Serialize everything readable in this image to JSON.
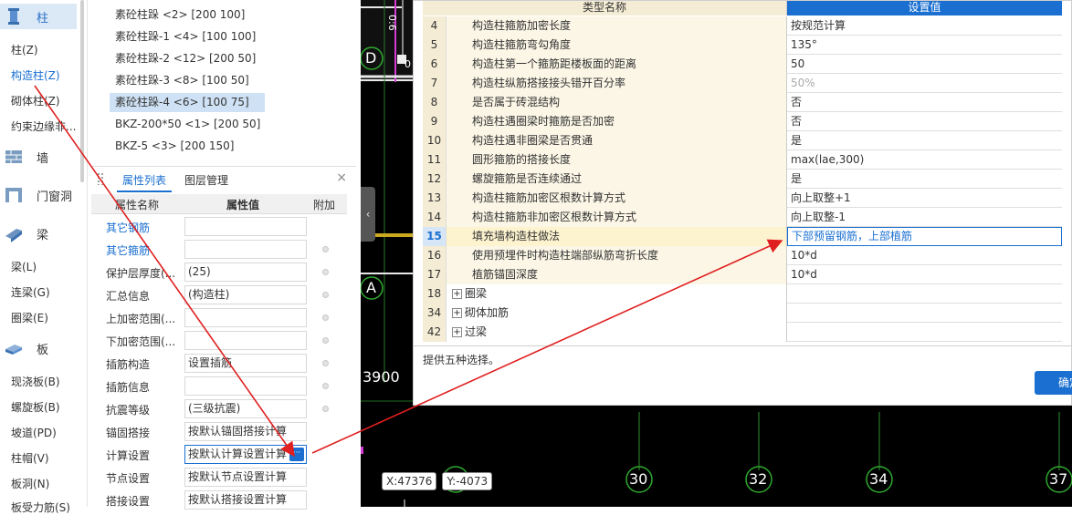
{
  "nav": {
    "categories": [
      {
        "label": "柱",
        "icon": "column-icon",
        "selected": true
      },
      {
        "label": "墙",
        "icon": "wall-icon"
      },
      {
        "label": "门窗洞",
        "icon": "door-window-icon"
      },
      {
        "label": "梁",
        "icon": "beam-icon"
      },
      {
        "label": "板",
        "icon": "slab-icon"
      }
    ],
    "column_items": [
      "柱(Z)",
      "构造柱(Z)",
      "砌体柱(Z)",
      "约束边缘非..."
    ],
    "beam_items": [
      "梁(L)",
      "连梁(G)",
      "圈梁(E)"
    ],
    "slab_items": [
      "现浇板(B)",
      "螺旋板(B)",
      "坡道(PD)",
      "柱帽(V)",
      "板洞(N)",
      "板受力筋(S)"
    ]
  },
  "instances": [
    {
      "label": "素砼柱跺 <2> [200 100]"
    },
    {
      "label": "素砼柱跺-1 <4> [100 100]"
    },
    {
      "label": "素砼柱跺-2 <12> [200 50]"
    },
    {
      "label": "素砼柱跺-3 <8> [100 50]"
    },
    {
      "label": "素砼柱跺-4 <6> [100 75]",
      "selected": true
    },
    {
      "label": "BKZ-200*50 <1> [200 50]"
    },
    {
      "label": "BKZ-5 <3> [200 150]"
    }
  ],
  "property_panel": {
    "tab_attr": "属性列表",
    "tab_layer": "图层管理",
    "close": "×",
    "col_name": "属性名称",
    "col_value": "属性值",
    "col_extra": "附加",
    "rows": [
      {
        "name": "其它钢筋",
        "value": "",
        "link": true,
        "dot": false
      },
      {
        "name": "其它箍筋",
        "value": "",
        "link": true,
        "dot": true
      },
      {
        "name": "保护层厚度(...",
        "value": "(25)",
        "dot": true
      },
      {
        "name": "汇总信息",
        "value": "(构造柱)",
        "dot": true
      },
      {
        "name": "上加密范围(...",
        "value": "",
        "dot": true
      },
      {
        "name": "下加密范围(...",
        "value": "",
        "dot": true
      },
      {
        "name": "插筋构造",
        "value": "设置插筋",
        "dot": true
      },
      {
        "name": "插筋信息",
        "value": "",
        "dot": true
      },
      {
        "name": "抗震等级",
        "value": "(三级抗震)",
        "dot": true
      },
      {
        "name": "锚固搭接",
        "value": "按默认锚固搭接计算",
        "dot": false
      },
      {
        "name": "计算设置",
        "value": "按默认计算设置计算",
        "dot": false,
        "active": true,
        "ellipsis": "···"
      },
      {
        "name": "节点设置",
        "value": "按默认节点设置计算",
        "dot": false
      },
      {
        "name": "搭接设置",
        "value": "按默认搭接设置计算",
        "dot": false
      }
    ]
  },
  "cad": {
    "axis_labels": [
      "D",
      "A",
      "30",
      "32",
      "34",
      "37"
    ],
    "dim_left": "3900",
    "dim_top": "0:6",
    "dim_side": "0",
    "coord_x": "X:47376",
    "coord_y": "Y:-4073",
    "partial_axis": "2"
  },
  "dialog": {
    "col_name": "类型名称",
    "col_value": "设置值",
    "rows": [
      {
        "num": "4",
        "name": "构造柱箍筋加密长度",
        "value": "按规范计算"
      },
      {
        "num": "5",
        "name": "构造柱箍筋弯勾角度",
        "value": "135°"
      },
      {
        "num": "6",
        "name": "构造柱第一个箍筋距楼板面的距离",
        "value": "50"
      },
      {
        "num": "7",
        "name": "构造柱纵筋搭接接头错开百分率",
        "value": "50%",
        "gray": true
      },
      {
        "num": "8",
        "name": "是否属于砖混结构",
        "value": "否"
      },
      {
        "num": "9",
        "name": "构造柱遇圈梁时箍筋是否加密",
        "value": "否"
      },
      {
        "num": "10",
        "name": "构造柱遇非圈梁是否贯通",
        "value": "是"
      },
      {
        "num": "11",
        "name": "圆形箍筋的搭接长度",
        "value": "max(lae,300)"
      },
      {
        "num": "12",
        "name": "螺旋箍筋是否连续通过",
        "value": "是"
      },
      {
        "num": "13",
        "name": "构造柱箍筋加密区根数计算方式",
        "value": "向上取整+1"
      },
      {
        "num": "14",
        "name": "构造柱箍筋非加密区根数计算方式",
        "value": "向上取整-1"
      },
      {
        "num": "15",
        "name": "填充墙构造柱做法",
        "value": "下部预留钢筋，上部植筋",
        "current": true
      },
      {
        "num": "16",
        "name": "使用预埋件时构造柱端部纵筋弯折长度",
        "value": "10*d"
      },
      {
        "num": "17",
        "name": "植筋锚固深度",
        "value": "10*d"
      },
      {
        "num": "18",
        "name": "圈梁",
        "value": "",
        "group": true,
        "expander": "+"
      },
      {
        "num": "34",
        "name": "砌体加筋",
        "value": "",
        "group": true,
        "expander": "+"
      },
      {
        "num": "42",
        "name": "过梁",
        "value": "",
        "group": true,
        "expander": "+"
      }
    ],
    "description": "提供五种选择。",
    "ok": "确定"
  },
  "colors": {
    "accent": "#1a6fd0",
    "annotation": "#e02020",
    "header_tan": "#f4ecd4",
    "cad_bg": "#000000"
  }
}
